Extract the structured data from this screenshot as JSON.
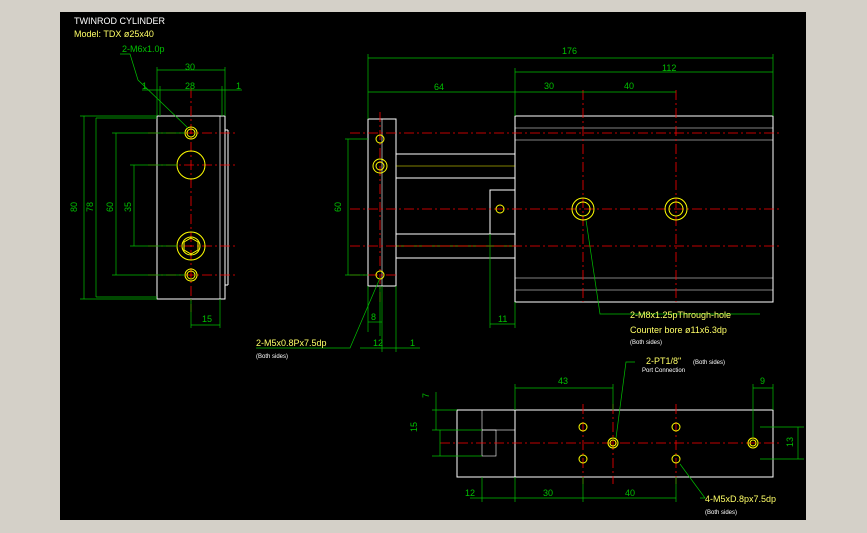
{
  "title": {
    "line1": "TWINROD CYLINDER",
    "line2": "Model: TDX ø25x40"
  },
  "colors": {
    "background": "#000000",
    "frame": "#d4d0c8",
    "outline": "#ffffff",
    "dimension": "#00c000",
    "centerline": "#ff0000",
    "feature": "#ffff00"
  },
  "side_view": {
    "callout": "2-M6x1.0p",
    "dim_30": "30",
    "dim_28": "28",
    "dim_1a": "1",
    "dim_1b": "1",
    "dim_80": "80",
    "dim_78": "78",
    "dim_60": "60",
    "dim_35": "35",
    "dim_15": "15"
  },
  "front_view": {
    "dim_176": "176",
    "dim_112": "112",
    "dim_64": "64",
    "dim_30": "30",
    "dim_40": "40",
    "dim_60": "60",
    "dim_8": "8",
    "dim_12": "12",
    "dim_1": "1",
    "dim_11": "11",
    "callout_m5": "2-M5x0.8Px7.5dp",
    "callout_m5_note": "(Both sides)",
    "callout_m8": "2-M8x1.25pThrough-hole",
    "callout_cbore": "Counter bore ø11x6.3dp",
    "callout_cbore_note": "(Both sides)"
  },
  "bottom_view": {
    "dim_43": "43",
    "dim_9": "9",
    "dim_7": "7",
    "dim_15": "15",
    "dim_13": "13",
    "dim_12": "12",
    "dim_30": "30",
    "dim_40": "40",
    "callout_pt": "2-PT1/8\"",
    "callout_pt_note": "(Both sides)",
    "callout_port": "Port Connection",
    "callout_m5": "4-M5xD.8px7.5dp",
    "callout_m5_note": "(Both sides)"
  }
}
